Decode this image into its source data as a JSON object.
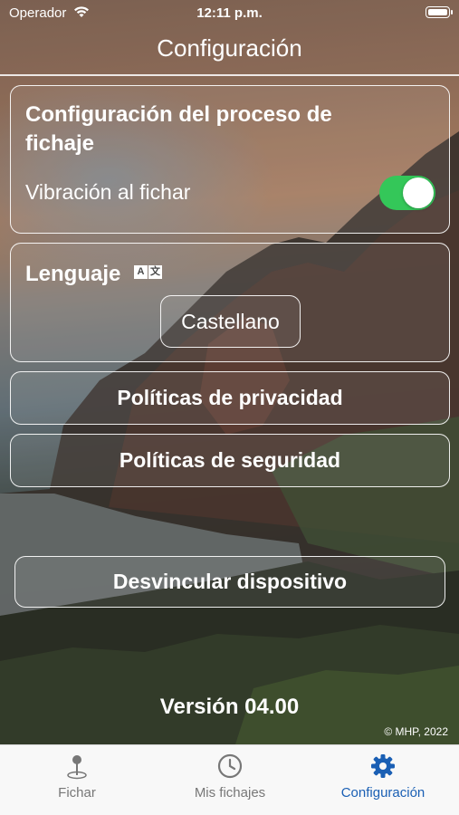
{
  "status_bar": {
    "carrier": "Operador",
    "time": "12:11 p.m."
  },
  "header": {
    "title": "Configuración"
  },
  "process_section": {
    "title": "Configuración del proceso de fichaje",
    "vibration_label": "Vibración al fichar",
    "vibration_enabled": true
  },
  "language_section": {
    "title": "Lenguaje",
    "icon": "translate-icon",
    "selected_language": "Castellano"
  },
  "buttons": {
    "privacy": "Políticas de privacidad",
    "security": "Políticas de seguridad",
    "unlink": "Desvincular dispositivo"
  },
  "footer": {
    "version": "Versión 04.00",
    "copyright": "© MHP, 2022"
  },
  "tabbar": {
    "items": [
      {
        "label": "Fichar",
        "icon": "map-pin-icon"
      },
      {
        "label": "Mis fichajes",
        "icon": "clock-icon"
      },
      {
        "label": "Configuración",
        "icon": "gear-icon"
      }
    ],
    "active_index": 2
  },
  "colors": {
    "toggle_on": "#34c759",
    "tab_active": "#1a5fb4",
    "tab_inactive": "#777777"
  }
}
